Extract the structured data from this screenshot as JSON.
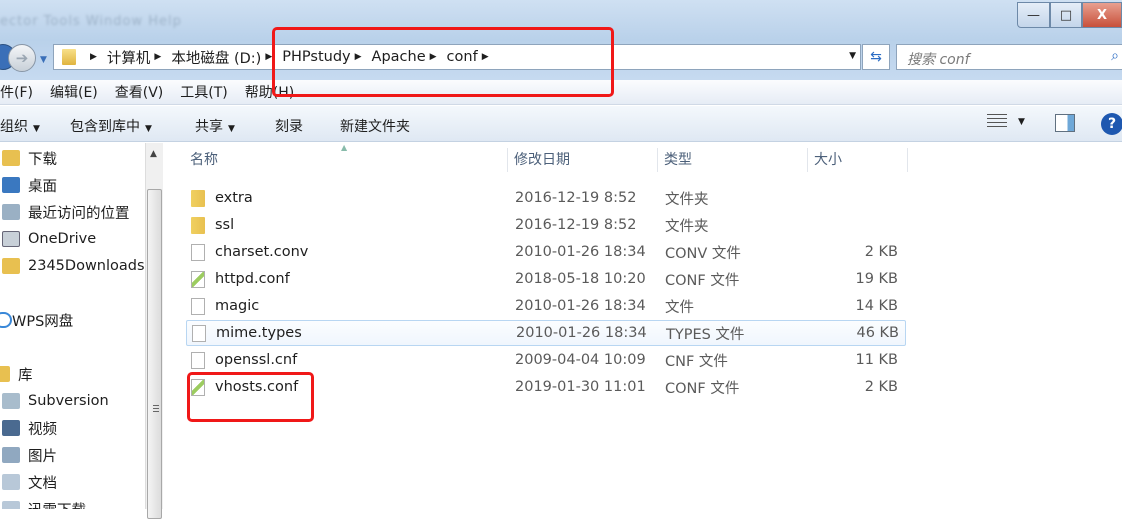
{
  "window": {
    "background_menu": "ector  Tools  Window  Help",
    "minimize": "—",
    "maximize": "□",
    "close": "X"
  },
  "address": {
    "crumbs": [
      "计算机",
      "本地磁盘 (D:)",
      "PHPstudy",
      "Apache",
      "conf"
    ],
    "search_placeholder": "搜索 conf"
  },
  "menu": [
    "件(F)",
    "编辑(E)",
    "查看(V)",
    "工具(T)",
    "帮助(H)"
  ],
  "toolbar": {
    "organize": "组织",
    "include_library": "包含到库中",
    "share": "共享",
    "burn": "刻录",
    "new_folder": "新建文件夹",
    "help": "?"
  },
  "sidebar": [
    {
      "label": "下载",
      "icon": "downloads-icon"
    },
    {
      "label": "桌面",
      "icon": "desktop-icon"
    },
    {
      "label": "最近访问的位置",
      "icon": "recent-places-icon"
    },
    {
      "label": "OneDrive",
      "icon": "onedrive-icon"
    },
    {
      "label": "2345Downloads",
      "icon": "folder-icon"
    },
    {
      "label": "WPS网盘",
      "icon": "cloud-icon"
    },
    {
      "label": "库",
      "icon": "library-icon"
    },
    {
      "label": "Subversion",
      "icon": "subversion-icon"
    },
    {
      "label": "视频",
      "icon": "video-icon"
    },
    {
      "label": "图片",
      "icon": "pictures-icon"
    },
    {
      "label": "文档",
      "icon": "documents-icon"
    },
    {
      "label": "迅雷下载",
      "icon": "folder-icon"
    }
  ],
  "columns": {
    "name": "名称",
    "date": "修改日期",
    "type": "类型",
    "size": "大小"
  },
  "files": [
    {
      "name": "extra",
      "date": "2016-12-19 8:52",
      "type": "文件夹",
      "size": "",
      "kind": "folder"
    },
    {
      "name": "ssl",
      "date": "2016-12-19 8:52",
      "type": "文件夹",
      "size": "",
      "kind": "folder"
    },
    {
      "name": "charset.conv",
      "date": "2010-01-26 18:34",
      "type": "CONV 文件",
      "size": "2 KB",
      "kind": "file"
    },
    {
      "name": "httpd.conf",
      "date": "2018-05-18 10:20",
      "type": "CONF 文件",
      "size": "19 KB",
      "kind": "conf"
    },
    {
      "name": "magic",
      "date": "2010-01-26 18:34",
      "type": "文件",
      "size": "14 KB",
      "kind": "file"
    },
    {
      "name": "mime.types",
      "date": "2010-01-26 18:34",
      "type": "TYPES 文件",
      "size": "46 KB",
      "kind": "file"
    },
    {
      "name": "openssl.cnf",
      "date": "2009-04-04 10:09",
      "type": "CNF 文件",
      "size": "11 KB",
      "kind": "file"
    },
    {
      "name": "vhosts.conf",
      "date": "2019-01-30 11:01",
      "type": "CONF 文件",
      "size": "2 KB",
      "kind": "conf"
    }
  ],
  "colors": {
    "highlight": "#f01818",
    "accent": "#2b6cc4"
  }
}
